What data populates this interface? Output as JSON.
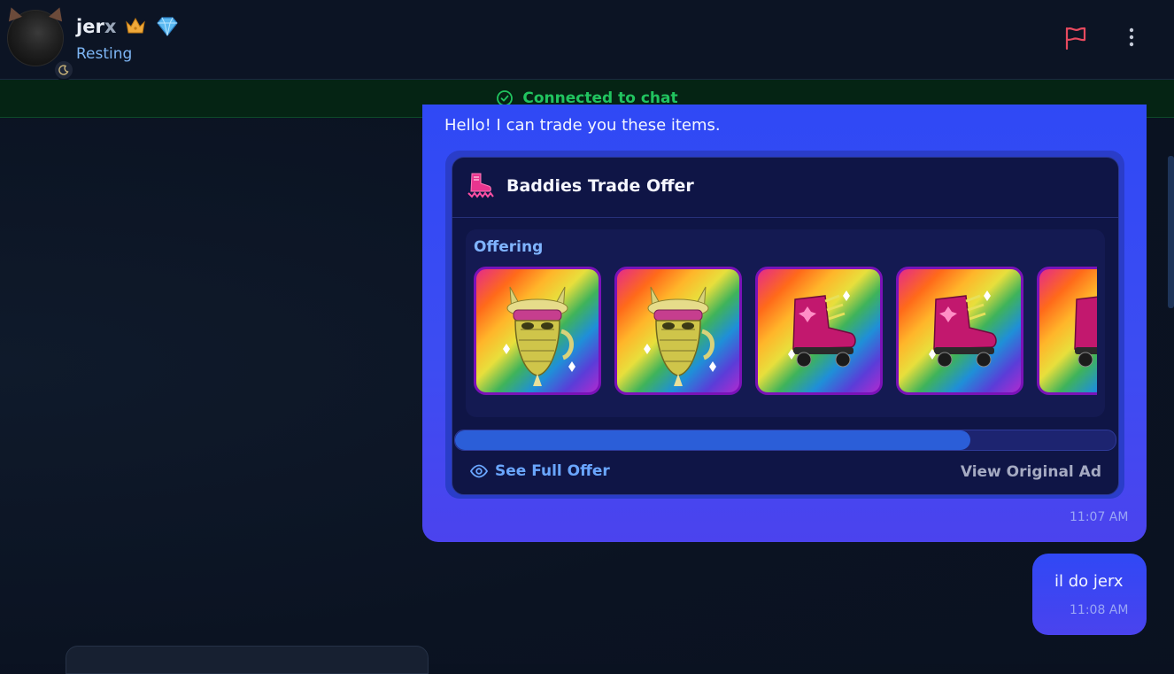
{
  "header": {
    "username_main": "jer",
    "username_tail": "x",
    "status": "Resting",
    "crown_icon": "crown-icon",
    "diamond_icon": "diamond-icon"
  },
  "banner": {
    "text": "Connected to chat"
  },
  "messages": [
    {
      "text": "Hello! I can trade you these items.",
      "time": "11:07 AM",
      "card": {
        "title": "Baddies Trade Offer",
        "section_label": "Offering",
        "scroll_progress": 0.78,
        "items": [
          {
            "name": "golden-cat-mask-item"
          },
          {
            "name": "golden-cat-mask-item"
          },
          {
            "name": "pink-roller-skate-item"
          },
          {
            "name": "pink-roller-skate-item"
          },
          {
            "name": "pink-roller-skate-item"
          }
        ],
        "see_full_label": "See Full Offer",
        "view_original_label": "View Original Ad"
      }
    },
    {
      "text": "il do jerx",
      "time": "11:08 AM"
    }
  ],
  "colors": {
    "accent": "#3d4cf2",
    "connected": "#21c45f",
    "status": "#7eb6f5",
    "flag": "#e84a5f"
  }
}
